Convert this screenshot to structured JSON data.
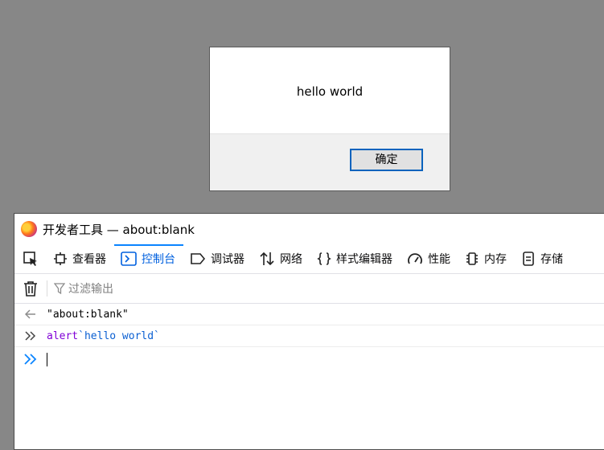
{
  "alert": {
    "message": "hello world",
    "ok_label": "确定"
  },
  "devtools": {
    "window_title": "开发者工具 — about:blank",
    "tabs": [
      {
        "label": "查看器",
        "icon": "inspector-icon"
      },
      {
        "label": "控制台",
        "icon": "console-icon",
        "active": true
      },
      {
        "label": "调试器",
        "icon": "debugger-icon"
      },
      {
        "label": "网络",
        "icon": "network-icon"
      },
      {
        "label": "样式编辑器",
        "icon": "style-editor-icon"
      },
      {
        "label": "性能",
        "icon": "performance-icon"
      },
      {
        "label": "内存",
        "icon": "memory-icon"
      },
      {
        "label": "存储",
        "icon": "storage-icon"
      }
    ],
    "filter_placeholder": "过滤输出",
    "console": {
      "result_text": "\"about:blank\"",
      "input_keyword": "alert",
      "input_template": "`hello world`"
    }
  },
  "colors": {
    "accent": "#0a84ff",
    "keyword": "#8000d7",
    "template_string": "#0a5fd2"
  }
}
